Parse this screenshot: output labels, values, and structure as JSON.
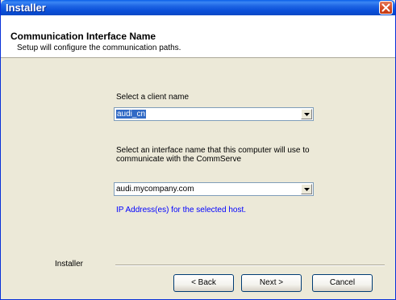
{
  "window": {
    "title": "Installer"
  },
  "header": {
    "title": "Communication Interface Name",
    "subtitle": "Setup will configure the communication paths."
  },
  "client": {
    "label": "Select a client name",
    "selected_value": "audi_cn"
  },
  "interface": {
    "label_line1": "Select an interface name that this computer will use to",
    "label_line2": "communicate with the CommServe",
    "selected_value": "audi.mycompany.com"
  },
  "ip_info": {
    "text": "IP Address(es) for the selected host."
  },
  "footer": {
    "label": "Installer"
  },
  "buttons": {
    "back": "< Back",
    "next": "Next >",
    "cancel": "Cancel"
  },
  "colors": {
    "titlebar": "#0a4fd9",
    "dialog_bg": "#ece9d8",
    "selection": "#316ac5",
    "link": "#0000ff"
  }
}
